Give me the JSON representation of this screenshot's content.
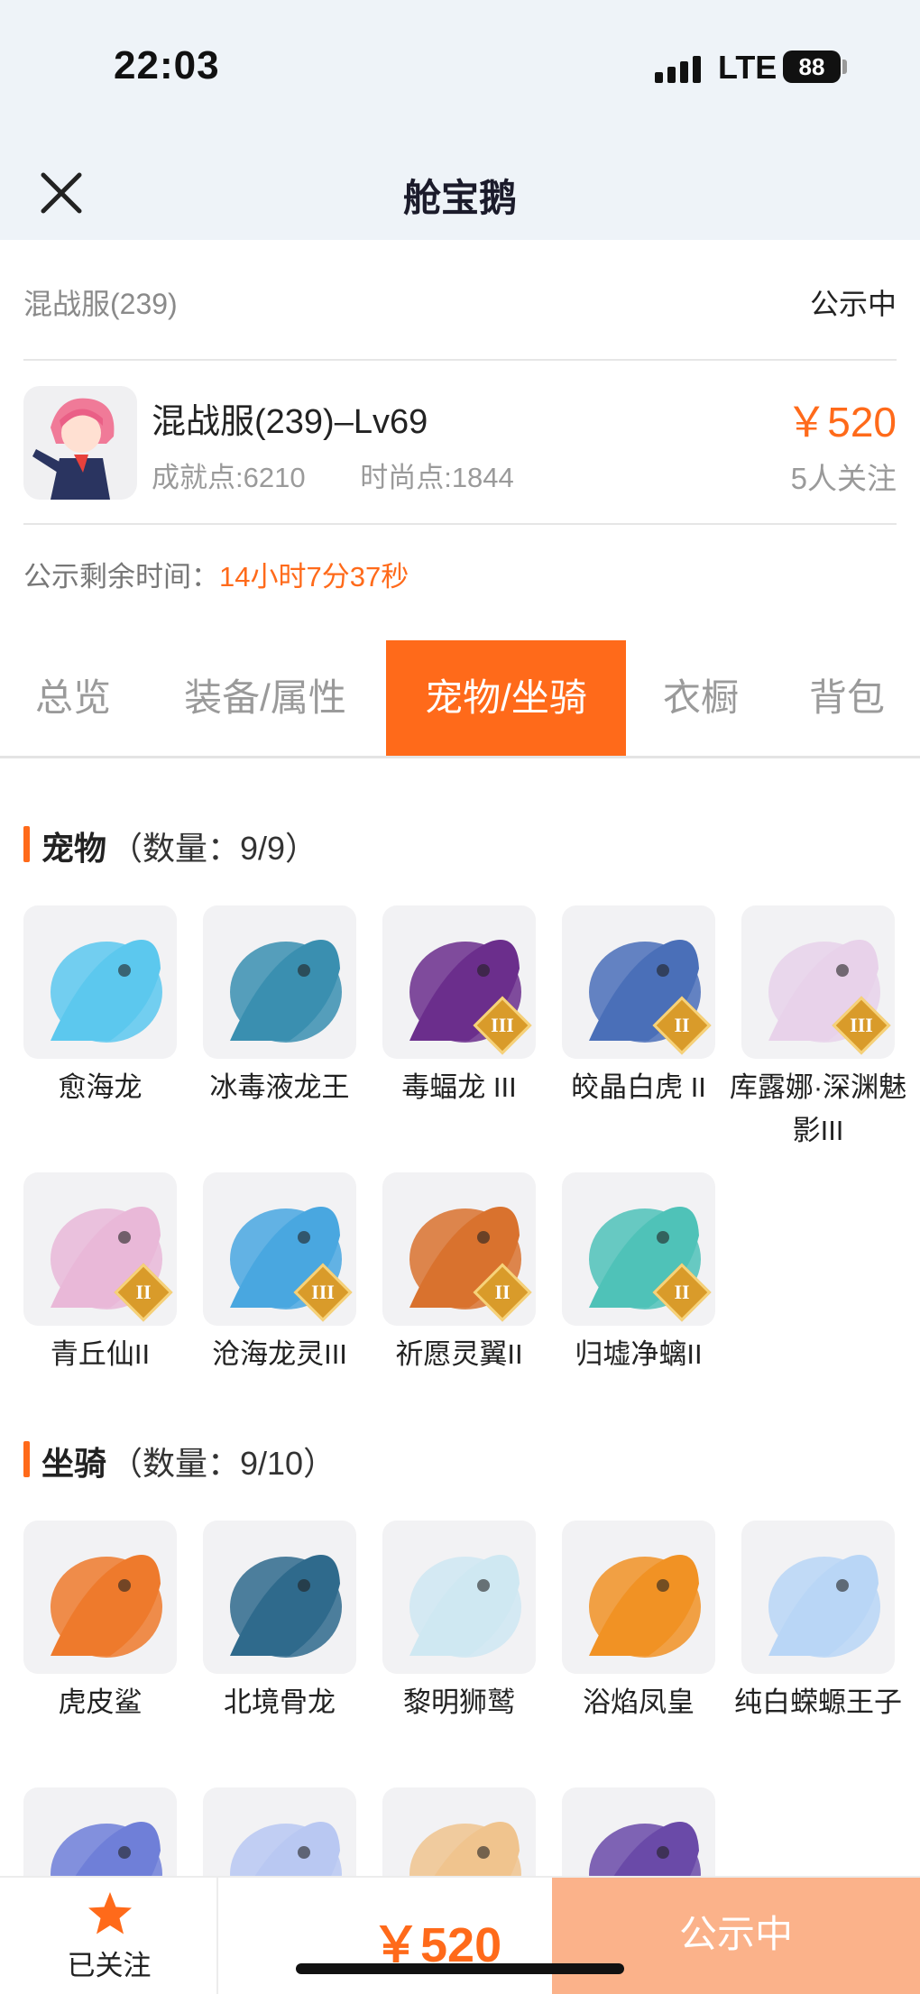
{
  "status_bar": {
    "time": "22:03",
    "network": "LTE",
    "battery": "88"
  },
  "nav": {
    "title": "舱宝鹅"
  },
  "listing": {
    "server": "混战服(239)",
    "status": "公示中",
    "character": "混战服(239)–Lv69",
    "achievement": "成就点:6210",
    "fashion": "时尚点:1844",
    "price": "￥520",
    "followers": "5人关注",
    "remain_label": "公示剩余时间：",
    "remain_value": "14小时7分37秒"
  },
  "tabs": [
    "总览",
    "装备/属性",
    "宠物/坐骑",
    "衣橱",
    "背包"
  ],
  "active_tab": "宠物/坐骑",
  "pets": {
    "title": "宠物",
    "count": "（数量：9/9）",
    "items": [
      {
        "name": "愈海龙",
        "badge": "",
        "color": "#5cc8ee",
        "icon": "sea-dragon-icon"
      },
      {
        "name": "冰毒液龙王",
        "badge": "",
        "color": "#3a8fb0",
        "icon": "venom-dragon-icon"
      },
      {
        "name": "毒蝠龙 III",
        "badge": "III",
        "color": "#6b2e8c",
        "icon": "bat-dragon-icon"
      },
      {
        "name": "皎晶白虎 II",
        "badge": "II",
        "color": "#4a6fb8",
        "icon": "white-tiger-icon"
      },
      {
        "name": "库露娜·深渊魅影III",
        "badge": "III",
        "color": "#e8d2ea",
        "icon": "kuluna-icon"
      },
      {
        "name": "青丘仙II",
        "badge": "II",
        "color": "#e9b8d8",
        "icon": "fox-fairy-icon"
      },
      {
        "name": "沧海龙灵III",
        "badge": "III",
        "color": "#49a7e0",
        "icon": "ocean-dragon-spirit-icon"
      },
      {
        "name": "祈愿灵翼II",
        "badge": "II",
        "color": "#d9722e",
        "icon": "wish-wing-icon"
      },
      {
        "name": "归墟净螭II",
        "badge": "II",
        "color": "#4fc2b8",
        "icon": "guixu-chi-icon"
      }
    ]
  },
  "mounts": {
    "title": "坐骑",
    "count": "（数量：9/10）",
    "items": [
      {
        "name": "虎皮鲨",
        "color": "#ee7a2c",
        "icon": "tiger-shark-icon"
      },
      {
        "name": "北境骨龙",
        "color": "#2f6a8c",
        "icon": "bone-dragon-icon"
      },
      {
        "name": "黎明狮鹫",
        "color": "#cfe8f2",
        "icon": "griffin-icon"
      },
      {
        "name": "浴焰凤皇",
        "color": "#f19224",
        "icon": "phoenix-icon"
      },
      {
        "name": "纯白蝾螈王子",
        "color": "#b9d6f6",
        "icon": "salamander-prince-icon"
      },
      {
        "name": "",
        "color": "#6f7fd8",
        "icon": "blue-dragon-icon"
      },
      {
        "name": "",
        "color": "#b9c8f2",
        "icon": "white-wolf-icon"
      },
      {
        "name": "",
        "color": "#f0c48e",
        "icon": "lion-icon"
      },
      {
        "name": "",
        "color": "#6a4aa8",
        "icon": "purple-dino-icon"
      }
    ]
  },
  "bottom": {
    "follow_label": "已关注",
    "price": "￥520",
    "action": "公示中"
  },
  "colors": {
    "accent": "#ff6a1a",
    "action_bg": "#fbb28a"
  }
}
